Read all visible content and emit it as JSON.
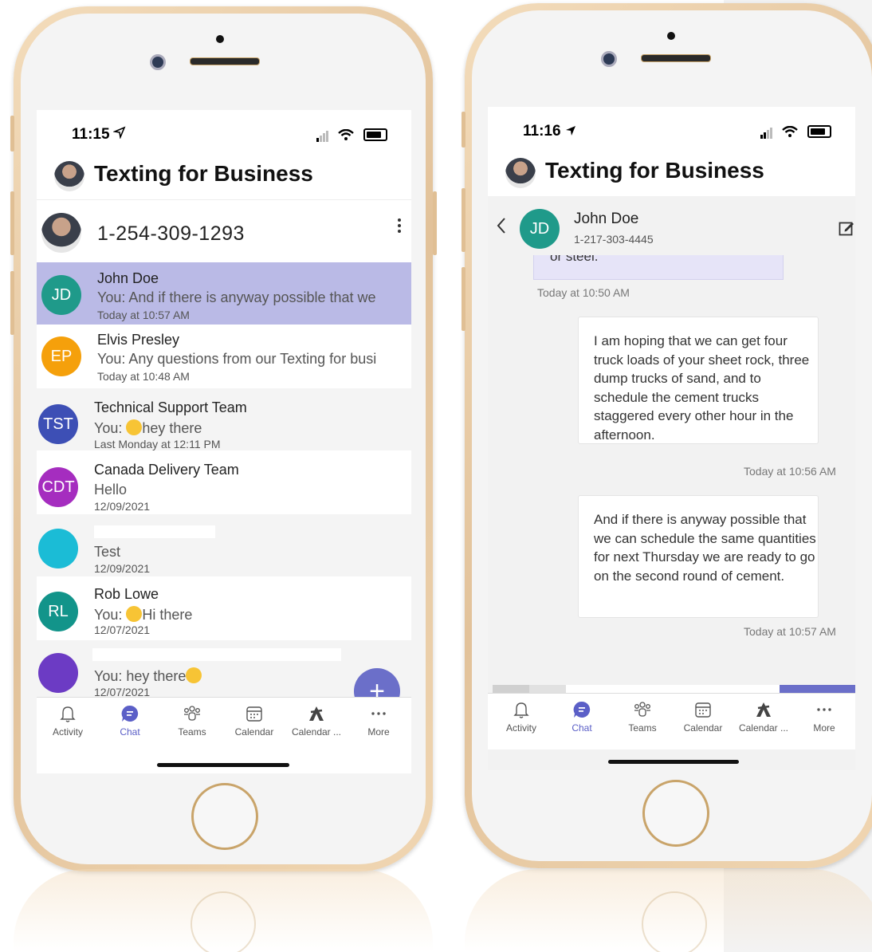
{
  "left": {
    "status_time": "11:15",
    "app_title": "Texting for Business",
    "account_number": "1-254-309-1293",
    "conversations": [
      {
        "initials": "JD",
        "name": "John Doe",
        "preview": "You: And if there is anyway possible that we",
        "time": "Today at 10:57 AM",
        "color": "#1f9a8a",
        "selected": true
      },
      {
        "initials": "EP",
        "name": "Elvis Presley",
        "preview": "You: Any questions from our Texting for busi",
        "time": "Today at 10:48 AM",
        "color": "#f5a00b"
      },
      {
        "initials": "TST",
        "name": "Technical Support Team",
        "preview_prefix": "You: ",
        "preview": "hey there",
        "time": "Last Monday at 12:11 PM",
        "color": "#3d4fb5"
      },
      {
        "initials": "CDT",
        "name": "Canada Delivery Team",
        "preview": "Hello",
        "time": "12/09/2021",
        "color": "#a52dbf"
      },
      {
        "initials": "",
        "name": "",
        "preview": "Test",
        "time": "12/09/2021",
        "color": "#1bbcd6"
      },
      {
        "initials": "RL",
        "name": "Rob Lowe",
        "preview_prefix": "You: ",
        "preview": "Hi there",
        "time": "12/07/2021",
        "color": "#12948a"
      },
      {
        "initials": "",
        "name": "",
        "preview": "You: hey there",
        "time": "12/07/2021",
        "color": "#6c3bc4"
      }
    ],
    "fab": "+"
  },
  "right": {
    "status_time": "11:16",
    "app_title": "Texting for Business",
    "contact_initials": "JD",
    "contact_name": "John Doe",
    "contact_phone": "1-217-303-4445",
    "clipped_text": "or steel.",
    "clipped_time": "Today at 10:50 AM",
    "messages": [
      {
        "text": "I am hoping that we can get four truck loads of your sheet rock, three dump trucks of sand, and to schedule the cement trucks staggered every other hour in the afternoon.",
        "time": "Today at 10:56 AM"
      },
      {
        "text": "And if there is anyway possible that we can schedule the same quantities for next Thursday we are ready to go on the second round of cement.",
        "time": "Today at 10:57 AM"
      }
    ]
  },
  "tabs": [
    {
      "label": "Activity",
      "icon": "bell-icon"
    },
    {
      "label": "Chat",
      "icon": "chat-icon"
    },
    {
      "label": "Teams",
      "icon": "teams-icon"
    },
    {
      "label": "Calendar",
      "icon": "calendar-icon"
    },
    {
      "label": "Calendar ...",
      "icon": "app-icon"
    },
    {
      "label": "More",
      "icon": "more-icon"
    }
  ],
  "colors": {
    "accent": "#5b5fc7",
    "selected_row": "#babae6",
    "frame": "#e2c29a"
  }
}
